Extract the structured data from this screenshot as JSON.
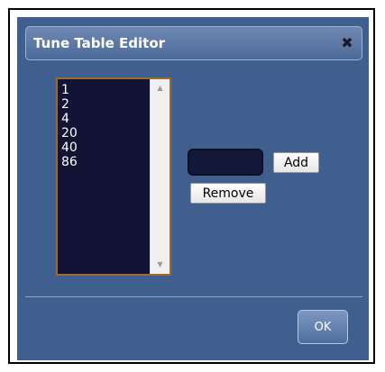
{
  "dialog": {
    "title": "Tune Table Editor",
    "close_icon": "close-icon"
  },
  "list": {
    "items": [
      "1",
      "2",
      "4",
      "20",
      "40",
      "86"
    ]
  },
  "input": {
    "value": ""
  },
  "buttons": {
    "add_label": "Add",
    "remove_label": "Remove",
    "ok_label": "OK"
  },
  "colors": {
    "dialog_bg": "#3f5f8f",
    "list_bg": "#121436",
    "list_border": "#9a6b2a"
  }
}
